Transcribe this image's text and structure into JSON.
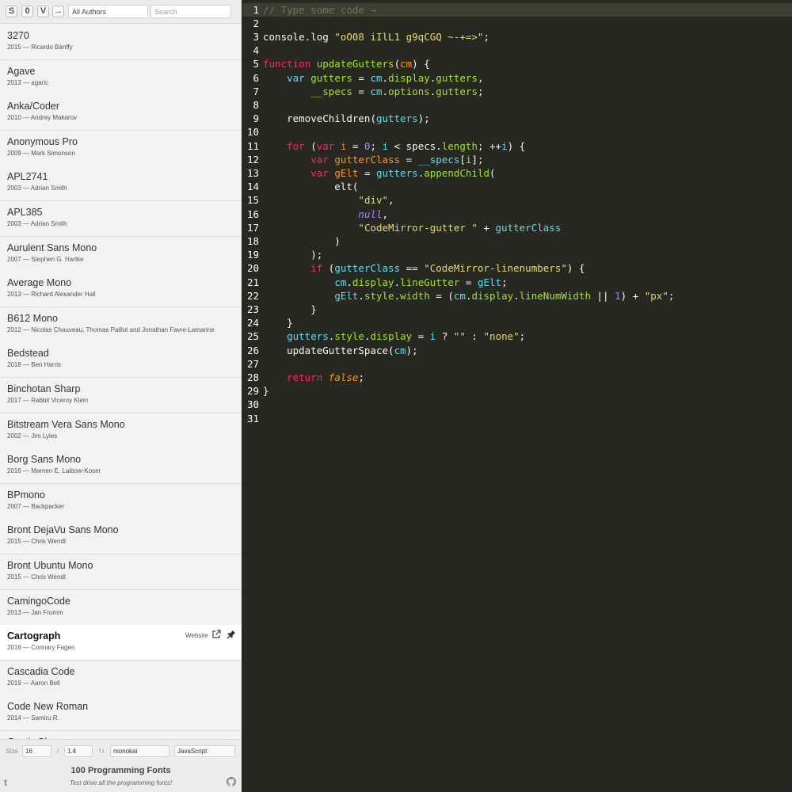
{
  "toolbar": {
    "btn_s": "S",
    "btn_zero": "0",
    "btn_v": "V",
    "btn_arrow": "→",
    "authors_value": "All Authors",
    "search_placeholder": "Search"
  },
  "fonts": [
    {
      "name": "3270",
      "meta": "2015 — Ricardo Bánffy"
    },
    {
      "name": "Agave",
      "meta": "2013 — agaric"
    },
    {
      "name": "Anka/Coder",
      "meta": "2010 — Andrey Makarov"
    },
    {
      "name": "Anonymous Pro",
      "meta": "2009 — Mark Simonson"
    },
    {
      "name": "APL2741",
      "meta": "2003 — Adrian Smith"
    },
    {
      "name": "APL385",
      "meta": "2003 — Adrian Smith"
    },
    {
      "name": "Aurulent Sans Mono",
      "meta": "2007 — Stephen G. Hartke"
    },
    {
      "name": "Average Mono",
      "meta": "2013 — Richard Alexander Hall"
    },
    {
      "name": "B612 Mono",
      "meta": "2012 — Nicolas Chauveau, Thomas Paillot and Jonathan Favre-Lamarine"
    },
    {
      "name": "Bedstead",
      "meta": "2018 — Ben Harris"
    },
    {
      "name": "Binchotan Sharp",
      "meta": "2017 — Rabbit Viceroy Klein"
    },
    {
      "name": "Bitstream Vera Sans Mono",
      "meta": "2002 — Jim Lyles"
    },
    {
      "name": "Borg Sans Mono",
      "meta": "2016 — Marnen E. Laibow-Koser"
    },
    {
      "name": "BPmono",
      "meta": "2007 — Backpacker"
    },
    {
      "name": "Bront DejaVu Sans Mono",
      "meta": "2015 — Chris Wendt"
    },
    {
      "name": "Bront Ubuntu Mono",
      "meta": "2015 — Chris Wendt"
    },
    {
      "name": "CamingoCode",
      "meta": "2013 — Jan Fromm"
    },
    {
      "name": "Cartograph",
      "meta": "2016 — Connary Fagen",
      "selected": true,
      "website": "Website"
    },
    {
      "name": "Cascadia Code",
      "meta": "2019 — Aaron Bell"
    },
    {
      "name": "Code New Roman",
      "meta": "2014 — Samiru R."
    },
    {
      "name": "Comic Shanns",
      "meta": ""
    }
  ],
  "bottom": {
    "size_label": "Size",
    "size_value": "16",
    "slash": "/",
    "line_height_value": "1.4",
    "sort_label": "↑↓",
    "theme_value": "monokai",
    "language_value": "JavaScript",
    "brand_title": "100 Programming Fonts",
    "brand_sub": "Test drive all the programming fonts!",
    "twitter": "t"
  },
  "editor": {
    "theme": "monokai",
    "line_count": 31,
    "lines": [
      [
        [
          "cm",
          "// Type some code →"
        ]
      ],
      [],
      [
        [
          "",
          "console.log "
        ],
        [
          "st",
          "\"oO08 iIlL1 g9qCGQ ~-+=>\""
        ],
        [
          "",
          ";"
        ]
      ],
      [],
      [
        [
          "kw",
          "function "
        ],
        [
          "fn",
          "updateGutters"
        ],
        [
          "",
          "("
        ],
        [
          "df",
          "cm"
        ],
        [
          "",
          ") {"
        ]
      ],
      [
        [
          "",
          "    "
        ],
        [
          "pr",
          "var "
        ],
        [
          "vr",
          "gutters"
        ],
        [
          "",
          " = "
        ],
        [
          "pr",
          "cm"
        ],
        [
          "",
          "."
        ],
        [
          "fn",
          "display"
        ],
        [
          "",
          "."
        ],
        [
          "fn",
          "gutters"
        ],
        [
          "",
          ","
        ]
      ],
      [
        [
          "",
          "        "
        ],
        [
          "vr",
          "__specs"
        ],
        [
          "",
          " = "
        ],
        [
          "pr",
          "cm"
        ],
        [
          "",
          "."
        ],
        [
          "fn",
          "options"
        ],
        [
          "",
          "."
        ],
        [
          "fn",
          "gutters"
        ],
        [
          "",
          ";"
        ]
      ],
      [],
      [
        [
          "",
          "    removeChildren("
        ],
        [
          "pr",
          "gutters"
        ],
        [
          "",
          ");"
        ]
      ],
      [],
      [
        [
          "",
          "    "
        ],
        [
          "kw",
          "for "
        ],
        [
          "",
          "("
        ],
        [
          "kw",
          "var "
        ],
        [
          "df",
          "i"
        ],
        [
          "",
          " = "
        ],
        [
          "nm",
          "0"
        ],
        [
          "",
          "; "
        ],
        [
          "pr",
          "i"
        ],
        [
          "",
          " < specs."
        ],
        [
          "fn",
          "length"
        ],
        [
          "",
          "; ++"
        ],
        [
          "pr",
          "i"
        ],
        [
          "",
          ") {"
        ]
      ],
      [
        [
          "",
          "        "
        ],
        [
          "kw",
          "var "
        ],
        [
          "df",
          "gutterClass"
        ],
        [
          "",
          " = "
        ],
        [
          "pr",
          "__specs"
        ],
        [
          "",
          "["
        ],
        [
          "pr",
          "i"
        ],
        [
          "",
          "];"
        ]
      ],
      [
        [
          "",
          "        "
        ],
        [
          "kw",
          "var "
        ],
        [
          "df",
          "gElt"
        ],
        [
          "",
          " = "
        ],
        [
          "pr",
          "gutters"
        ],
        [
          "",
          "."
        ],
        [
          "fn",
          "appendChild"
        ],
        [
          "",
          "("
        ]
      ],
      [
        [
          "",
          "            elt("
        ]
      ],
      [
        [
          "",
          "                "
        ],
        [
          "st",
          "\"div\""
        ],
        [
          "",
          ","
        ]
      ],
      [
        [
          "",
          "                "
        ],
        [
          "at",
          "null"
        ],
        [
          "",
          ","
        ]
      ],
      [
        [
          "",
          "                "
        ],
        [
          "st",
          "\"CodeMirror-gutter \""
        ],
        [
          "",
          " + "
        ],
        [
          "pr",
          "gutterClass"
        ]
      ],
      [
        [
          "",
          "            )"
        ]
      ],
      [
        [
          "",
          "        );"
        ]
      ],
      [
        [
          "",
          "        "
        ],
        [
          "kw",
          "if "
        ],
        [
          "",
          "("
        ],
        [
          "pr",
          "gutterClass"
        ],
        [
          "",
          " == "
        ],
        [
          "st",
          "\"CodeMirror-linenumbers\""
        ],
        [
          "",
          ") {"
        ]
      ],
      [
        [
          "",
          "            "
        ],
        [
          "pr",
          "cm"
        ],
        [
          "",
          "."
        ],
        [
          "fn",
          "display"
        ],
        [
          "",
          "."
        ],
        [
          "fn",
          "lineGutter"
        ],
        [
          "",
          " = "
        ],
        [
          "pr",
          "gElt"
        ],
        [
          "",
          ";"
        ]
      ],
      [
        [
          "",
          "            "
        ],
        [
          "pr",
          "gElt"
        ],
        [
          "",
          "."
        ],
        [
          "fn",
          "style"
        ],
        [
          "",
          "."
        ],
        [
          "fn",
          "width"
        ],
        [
          "",
          " = ("
        ],
        [
          "pr",
          "cm"
        ],
        [
          "",
          "."
        ],
        [
          "fn",
          "display"
        ],
        [
          "",
          "."
        ],
        [
          "fn",
          "lineNumWidth"
        ],
        [
          "",
          " || "
        ],
        [
          "nm",
          "1"
        ],
        [
          "",
          ") + "
        ],
        [
          "st",
          "\"px\""
        ],
        [
          "",
          ";"
        ]
      ],
      [
        [
          "",
          "        }"
        ]
      ],
      [
        [
          "",
          "    }"
        ]
      ],
      [
        [
          "",
          "    "
        ],
        [
          "pr",
          "gutters"
        ],
        [
          "",
          "."
        ],
        [
          "fn",
          "style"
        ],
        [
          "",
          "."
        ],
        [
          "fn",
          "display"
        ],
        [
          "",
          " = "
        ],
        [
          "pr",
          "i"
        ],
        [
          "",
          " ? "
        ],
        [
          "st",
          "\"\""
        ],
        [
          "",
          " : "
        ],
        [
          "st",
          "\"none\""
        ],
        [
          "",
          ";"
        ]
      ],
      [
        [
          "",
          "    updateGutterSpace("
        ],
        [
          "pr",
          "cm"
        ],
        [
          "",
          ");"
        ]
      ],
      [],
      [
        [
          "",
          "    "
        ],
        [
          "kw",
          "return "
        ],
        [
          "ar",
          "false"
        ],
        [
          "",
          ";"
        ]
      ],
      [
        [
          "",
          "}"
        ]
      ],
      [],
      []
    ]
  }
}
